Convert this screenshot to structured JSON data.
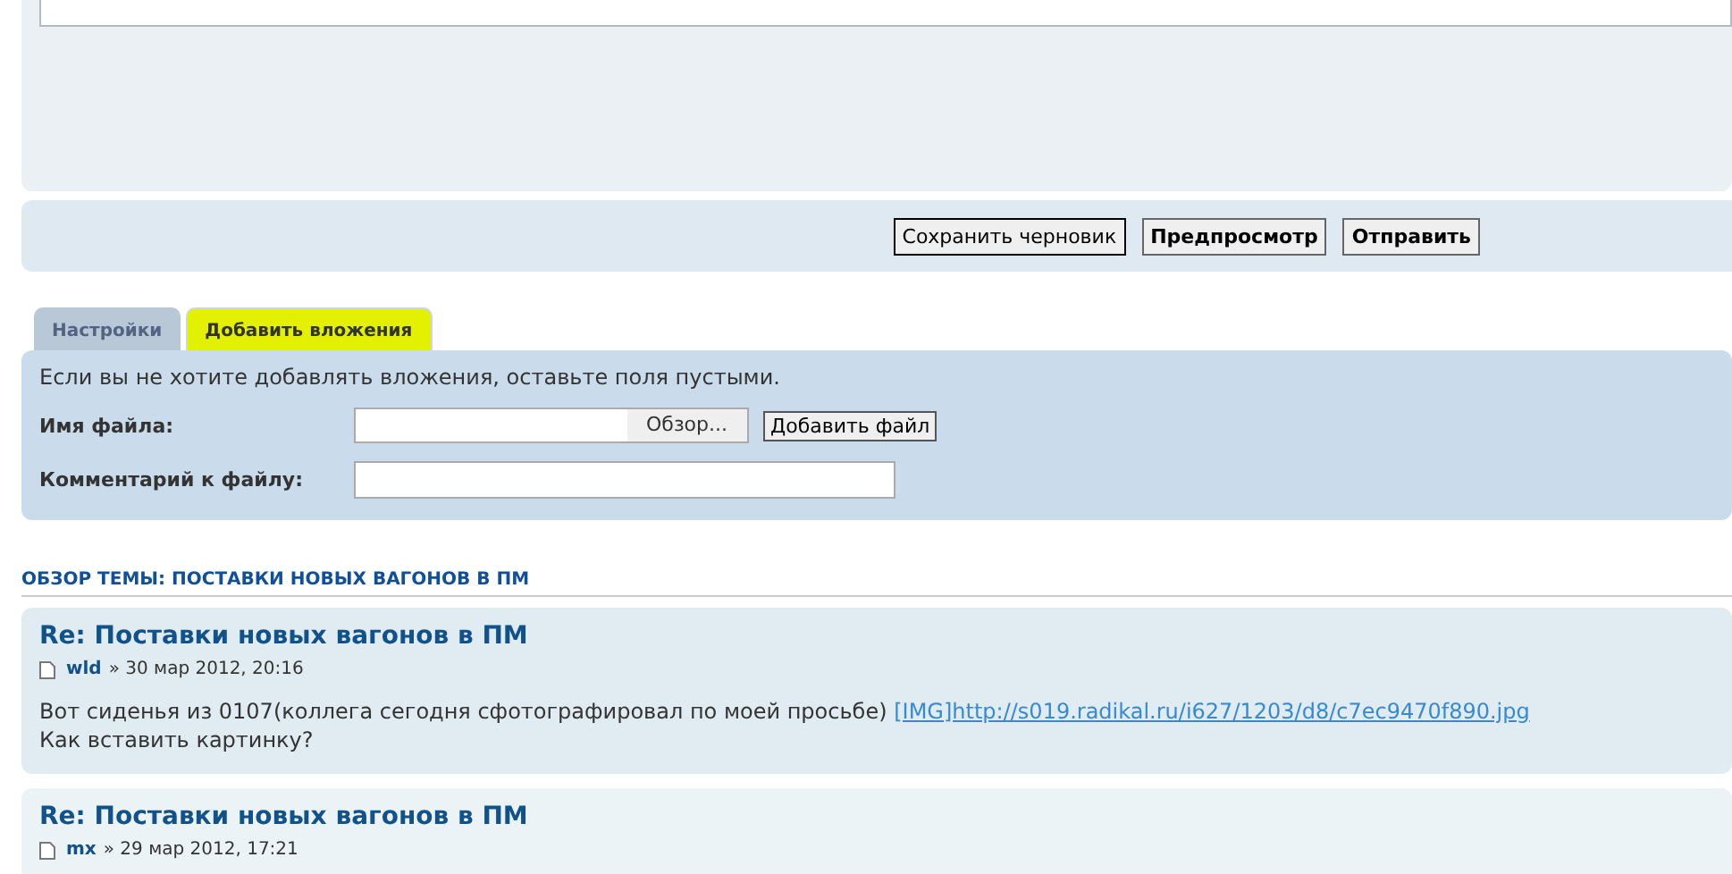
{
  "editor": {
    "kind": "textarea"
  },
  "buttons": [
    {
      "label": "Сохранить черновик",
      "bold": false
    },
    {
      "label": "Предпросмотр",
      "bold": true
    },
    {
      "label": "Отправить",
      "bold": true
    }
  ],
  "tabs": [
    {
      "label": "Настройки",
      "selected": false
    },
    {
      "label": "Добавить вложения",
      "selected": true
    }
  ],
  "attachments": {
    "note": "Если вы не хотите добавлять вложения, оставьте поля пустыми.",
    "file_label": "Имя файла:",
    "browse_button": "Обзор...",
    "add_button": "Добавить файл",
    "comment_label": "Комментарий к файлу:"
  },
  "topic_review": {
    "heading": "ОБЗОР ТЕМЫ: ПОСТАВКИ НОВЫХ ВАГОНОВ В ПМ",
    "posts": [
      {
        "title": "Re: Поставки новых вагонов в ПМ",
        "author": "wld",
        "date": "» 30 мар 2012, 20:16",
        "text": "Вот сиденья из 0107(коллега сегодня сфотографировал по моей просьбе)",
        "link": "[IMG]http://s019.radikal.ru/i627/1203/d8/c7ec9470f890.jpg",
        "text2": "Как вставить картинку?"
      },
      {
        "title": "Re: Поставки новых вагонов в ПМ",
        "author": "mx",
        "date": "» 29 мар 2012, 17:21"
      }
    ]
  }
}
